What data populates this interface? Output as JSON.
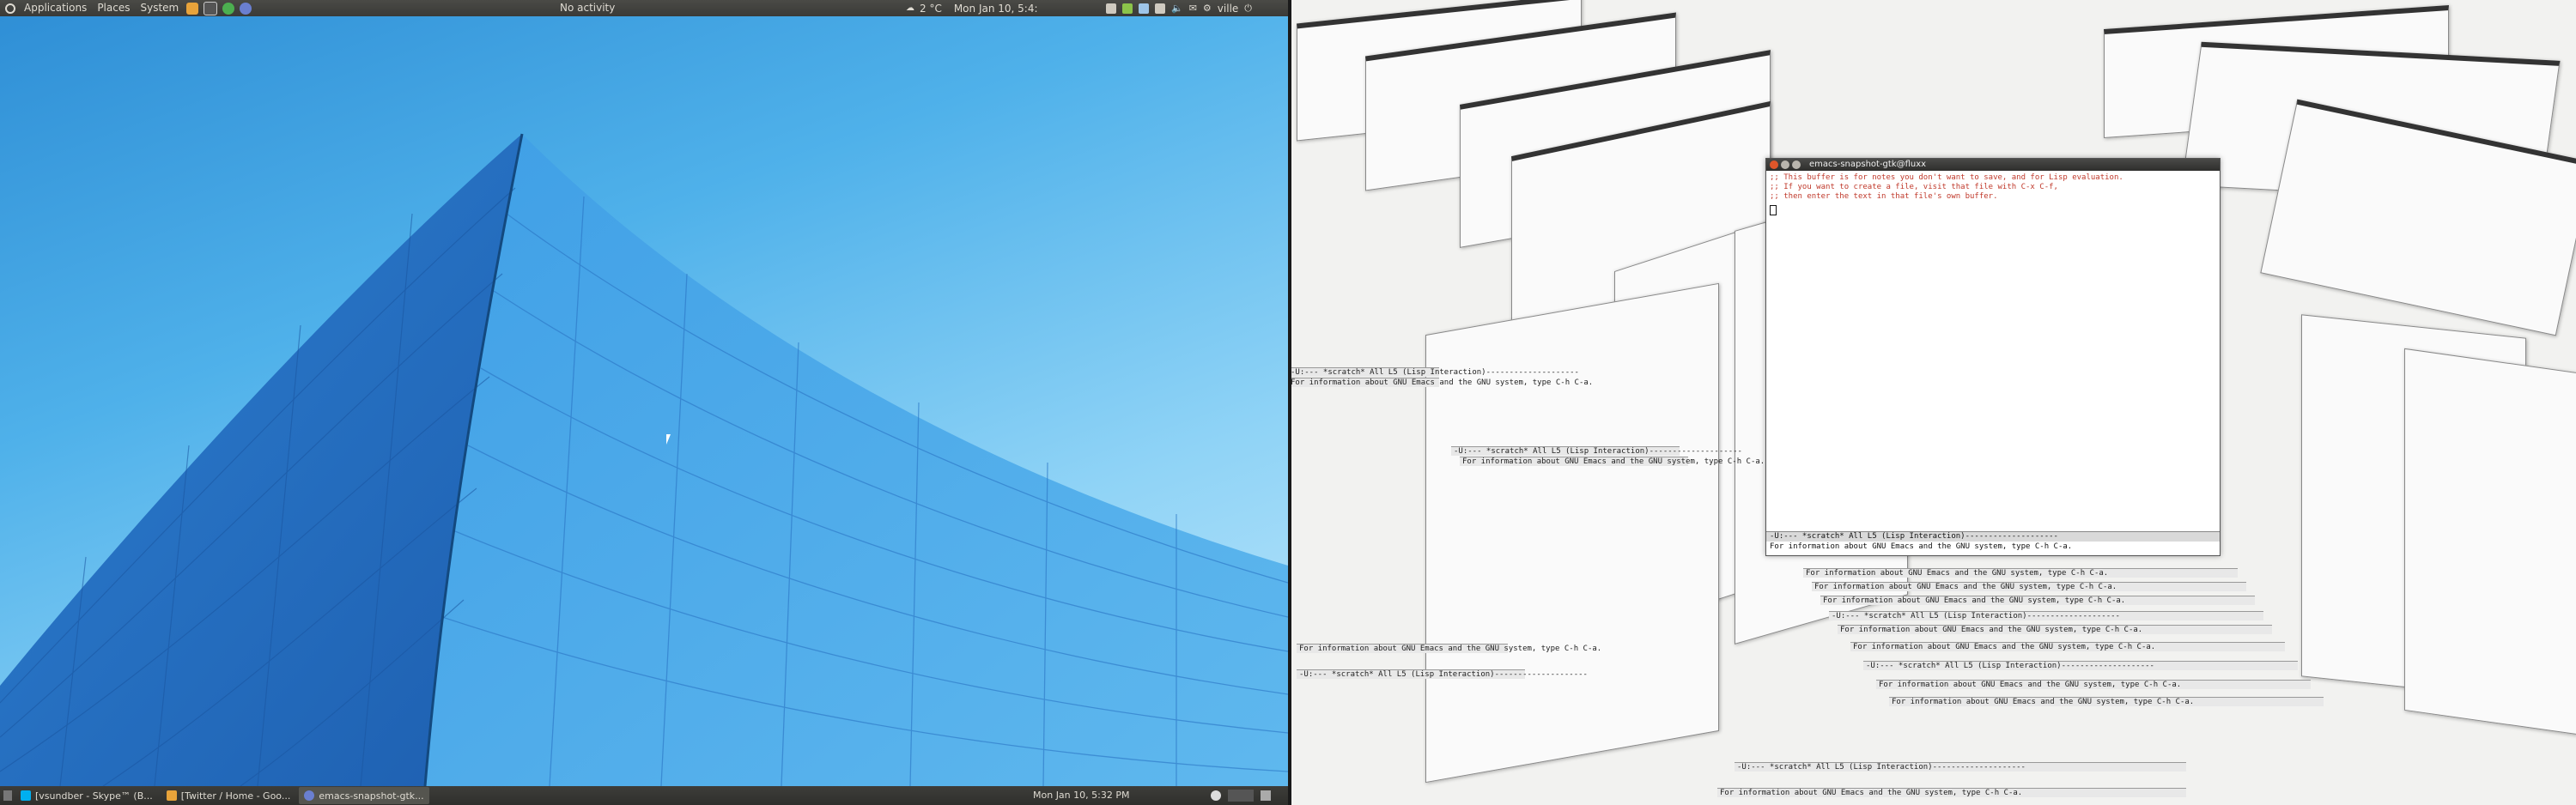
{
  "top_panel": {
    "menus": [
      "Applications",
      "Places",
      "System"
    ],
    "center_status": "No activity",
    "weather": "2 °C",
    "clock": "Mon Jan 10, 5:4:",
    "user": "ville"
  },
  "bottom_panel": {
    "tasks": [
      {
        "label": "[vsundber - Skype™ (B..."
      },
      {
        "label": "[Twitter / Home - Goo..."
      },
      {
        "label": "emacs-snapshot-gtk..."
      }
    ],
    "clock": "Mon Jan 10, 5:32 PM"
  },
  "emacs": {
    "title": "emacs-snapshot-gtk@fluxx",
    "lines": [
      ";; This buffer is for notes you don't want to save, and for Lisp evaluation.",
      ";; If you want to create a file, visit that file with C-x C-f,",
      ";; then enter the text in that file's own buffer."
    ],
    "modeline": "-U:---  *scratch*      All L5     (Lisp Interaction)--------------------",
    "echo": "For information about GNU Emacs and the GNU system, type C-h C-a."
  },
  "colors": {
    "panel": "#3c3b37",
    "sky": "#4fb1ea",
    "emacs_comment": "#c0392b",
    "titlebar_button": "#e0562a"
  }
}
